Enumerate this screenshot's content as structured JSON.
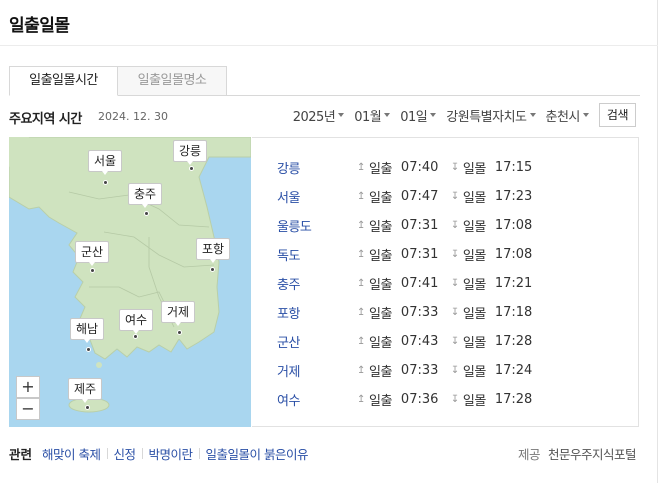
{
  "title": "일출일몰",
  "tabs": [
    {
      "label": "일출일몰시간",
      "active": true
    },
    {
      "label": "일출일몰명소",
      "active": false
    }
  ],
  "subheader": {
    "label": "주요지역 시간",
    "date": "2024. 12. 30"
  },
  "filters": {
    "year": "2025년",
    "month": "01월",
    "day": "01일",
    "province": "강원특별자치도",
    "city": "춘천시",
    "search_label": "검색"
  },
  "map": {
    "labels": [
      "강릉",
      "서울",
      "충주",
      "군산",
      "포항",
      "여수",
      "거제",
      "해남",
      "제주"
    ],
    "zoom_in": "+",
    "zoom_out": "−"
  },
  "rows": [
    {
      "city": "강릉",
      "sunrise": "07:40",
      "sunset": "17:15"
    },
    {
      "city": "서울",
      "sunrise": "07:47",
      "sunset": "17:23"
    },
    {
      "city": "울릉도",
      "sunrise": "07:31",
      "sunset": "17:08"
    },
    {
      "city": "독도",
      "sunrise": "07:31",
      "sunset": "17:08"
    },
    {
      "city": "충주",
      "sunrise": "07:41",
      "sunset": "17:21"
    },
    {
      "city": "포항",
      "sunrise": "07:33",
      "sunset": "17:18"
    },
    {
      "city": "군산",
      "sunrise": "07:43",
      "sunset": "17:28"
    },
    {
      "city": "거제",
      "sunrise": "07:33",
      "sunset": "17:24"
    },
    {
      "city": "여수",
      "sunrise": "07:36",
      "sunset": "17:28"
    }
  ],
  "labels": {
    "sunrise": "일출",
    "sunset": "일몰"
  },
  "related": {
    "heading": "관련",
    "links": [
      "해맞이 축제",
      "신정",
      "박명이란",
      "일출일몰이 붉은이유"
    ]
  },
  "provider": {
    "label": "제공",
    "name": "천문우주지식포털"
  },
  "colors": {
    "link": "#2a4fa6",
    "sea": "#a9d6ef",
    "land": "#cfe3bf"
  }
}
